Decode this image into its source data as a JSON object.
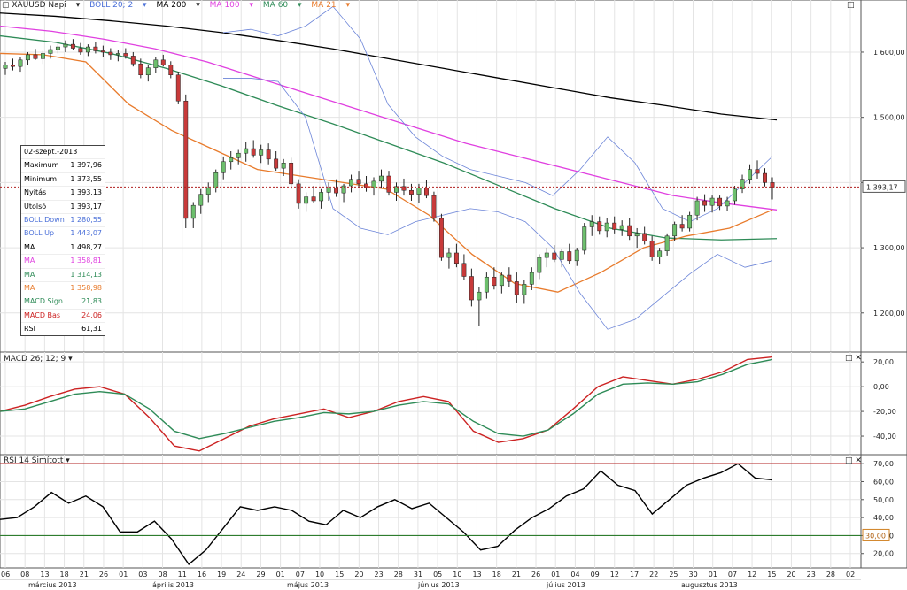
{
  "toolbar": {
    "symbol": "XAUUSD Napi",
    "indicators": [
      {
        "label": "BOLL 20; 2",
        "color": "#4a6fd8"
      },
      {
        "label": "MA 200",
        "color": "#000000"
      },
      {
        "label": "MA 100",
        "color": "#e040e0"
      },
      {
        "label": "MA 60",
        "color": "#2e8b57"
      },
      {
        "label": "MA 21",
        "color": "#e87b2c"
      }
    ]
  },
  "infobox": {
    "date": "02-szept.-2013",
    "rows": [
      {
        "label": "Maximum",
        "value": "1 397,96",
        "color": "#000000"
      },
      {
        "label": "Minimum",
        "value": "1 373,55",
        "color": "#000000"
      },
      {
        "label": "Nyitás",
        "value": "1 393,13",
        "color": "#000000"
      },
      {
        "label": "Utolsó",
        "value": "1 393,17",
        "color": "#000000"
      },
      {
        "label": "BOLL Down",
        "value": "1 280,55",
        "color": "#4a6fd8"
      },
      {
        "label": "BOLL Up",
        "value": "1 443,07",
        "color": "#4a6fd8"
      },
      {
        "label": "MA",
        "value": "1 498,27",
        "color": "#000000"
      },
      {
        "label": "MA",
        "value": "1 358,81",
        "color": "#e040e0"
      },
      {
        "label": "MA",
        "value": "1 314,13",
        "color": "#2e8b57"
      },
      {
        "label": "MA",
        "value": "1 358,98",
        "color": "#e87b2c"
      },
      {
        "label": "MACD Sign",
        "value": "21,83",
        "color": "#2e8b57"
      },
      {
        "label": "MACD Bas",
        "value": "24,06",
        "color": "#cc2222"
      },
      {
        "label": "RSI",
        "value": "61,31",
        "color": "#000000"
      }
    ]
  },
  "panels": {
    "macd_label": "MACD 26; 12; 9",
    "rsi_label": "RSI 14 Simított"
  },
  "last_price_label": "1 393,17",
  "rsi_level_label": "30,00",
  "x_ticks": [
    "06",
    "08",
    "13",
    "18",
    "21",
    "26",
    "01",
    "03",
    "08",
    "11",
    "16",
    "19",
    "24",
    "29",
    "01",
    "07",
    "10",
    "15",
    "20",
    "23",
    "28",
    "31",
    "05",
    "10",
    "13",
    "18",
    "21",
    "26",
    "01",
    "04",
    "09",
    "12",
    "17",
    "22",
    "25",
    "30",
    "01",
    "07",
    "12",
    "15",
    "20",
    "23",
    "28",
    "02"
  ],
  "month_labels": [
    "március 2013",
    "április 2013",
    "május 2013",
    "június 2013",
    "július 2013",
    "augusztus 2013"
  ],
  "chart_data": [
    {
      "type": "line",
      "title": "XAUUSD Napi",
      "ylim": [
        1140,
        1680
      ],
      "y_ticks": [
        "1 600,00",
        "1 500,00",
        "1 400,00",
        "1 300,00",
        "1 200,00"
      ],
      "candles": [
        [
          1575,
          1585,
          1565,
          1580
        ],
        [
          1580,
          1590,
          1572,
          1578
        ],
        [
          1578,
          1592,
          1570,
          1588
        ],
        [
          1588,
          1600,
          1580,
          1596
        ],
        [
          1596,
          1605,
          1588,
          1590
        ],
        [
          1590,
          1602,
          1582,
          1598
        ],
        [
          1598,
          1610,
          1590,
          1604
        ],
        [
          1604,
          1615,
          1598,
          1608
        ],
        [
          1608,
          1618,
          1600,
          1612
        ],
        [
          1612,
          1620,
          1604,
          1606
        ],
        [
          1606,
          1614,
          1596,
          1600
        ],
        [
          1600,
          1612,
          1594,
          1608
        ],
        [
          1608,
          1616,
          1598,
          1602
        ],
        [
          1602,
          1610,
          1592,
          1600
        ],
        [
          1600,
          1606,
          1588,
          1596
        ],
        [
          1596,
          1604,
          1586,
          1598
        ],
        [
          1598,
          1606,
          1590,
          1594
        ],
        [
          1594,
          1600,
          1578,
          1582
        ],
        [
          1582,
          1590,
          1560,
          1565
        ],
        [
          1565,
          1580,
          1555,
          1576
        ],
        [
          1576,
          1592,
          1568,
          1588
        ],
        [
          1588,
          1596,
          1578,
          1580
        ],
        [
          1580,
          1586,
          1560,
          1565
        ],
        [
          1565,
          1570,
          1520,
          1525
        ],
        [
          1525,
          1535,
          1330,
          1345
        ],
        [
          1345,
          1370,
          1330,
          1365
        ],
        [
          1365,
          1390,
          1352,
          1382
        ],
        [
          1382,
          1400,
          1370,
          1392
        ],
        [
          1392,
          1420,
          1385,
          1415
        ],
        [
          1415,
          1440,
          1405,
          1432
        ],
        [
          1432,
          1448,
          1420,
          1438
        ],
        [
          1438,
          1450,
          1428,
          1445
        ],
        [
          1445,
          1462,
          1432,
          1452
        ],
        [
          1452,
          1465,
          1438,
          1442
        ],
        [
          1442,
          1458,
          1430,
          1450
        ],
        [
          1450,
          1460,
          1428,
          1436
        ],
        [
          1436,
          1448,
          1418,
          1422
        ],
        [
          1422,
          1436,
          1410,
          1430
        ],
        [
          1430,
          1438,
          1390,
          1398
        ],
        [
          1398,
          1405,
          1360,
          1368
        ],
        [
          1368,
          1385,
          1355,
          1378
        ],
        [
          1378,
          1395,
          1368,
          1372
        ],
        [
          1372,
          1390,
          1360,
          1385
        ],
        [
          1385,
          1400,
          1372,
          1392
        ],
        [
          1392,
          1405,
          1378,
          1384
        ],
        [
          1384,
          1398,
          1370,
          1395
        ],
        [
          1395,
          1412,
          1385,
          1405
        ],
        [
          1405,
          1418,
          1392,
          1398
        ],
        [
          1398,
          1410,
          1386,
          1392
        ],
        [
          1392,
          1408,
          1380,
          1402
        ],
        [
          1402,
          1420,
          1392,
          1410
        ],
        [
          1410,
          1418,
          1380,
          1385
        ],
        [
          1385,
          1400,
          1372,
          1394
        ],
        [
          1394,
          1406,
          1380,
          1388
        ],
        [
          1388,
          1398,
          1372,
          1382
        ],
        [
          1382,
          1398,
          1368,
          1392
        ],
        [
          1392,
          1404,
          1376,
          1380
        ],
        [
          1380,
          1386,
          1340,
          1345
        ],
        [
          1345,
          1352,
          1280,
          1285
        ],
        [
          1285,
          1300,
          1268,
          1292
        ],
        [
          1292,
          1306,
          1270,
          1276
        ],
        [
          1276,
          1290,
          1250,
          1256
        ],
        [
          1256,
          1268,
          1210,
          1220
        ],
        [
          1220,
          1240,
          1180,
          1232
        ],
        [
          1232,
          1262,
          1222,
          1255
        ],
        [
          1255,
          1270,
          1236,
          1242
        ],
        [
          1242,
          1262,
          1230,
          1258
        ],
        [
          1258,
          1270,
          1240,
          1248
        ],
        [
          1248,
          1262,
          1216,
          1228
        ],
        [
          1228,
          1250,
          1214,
          1244
        ],
        [
          1244,
          1270,
          1235,
          1262
        ],
        [
          1262,
          1290,
          1252,
          1285
        ],
        [
          1285,
          1300,
          1270,
          1292
        ],
        [
          1292,
          1304,
          1278,
          1282
        ],
        [
          1282,
          1298,
          1270,
          1294
        ],
        [
          1294,
          1306,
          1275,
          1280
        ],
        [
          1280,
          1300,
          1272,
          1296
        ],
        [
          1296,
          1338,
          1290,
          1332
        ],
        [
          1332,
          1350,
          1318,
          1340
        ],
        [
          1340,
          1348,
          1320,
          1326
        ],
        [
          1326,
          1345,
          1316,
          1338
        ],
        [
          1338,
          1348,
          1322,
          1328
        ],
        [
          1328,
          1342,
          1318,
          1334
        ],
        [
          1334,
          1345,
          1312,
          1318
        ],
        [
          1318,
          1330,
          1300,
          1322
        ],
        [
          1322,
          1332,
          1305,
          1310
        ],
        [
          1310,
          1318,
          1280,
          1286
        ],
        [
          1286,
          1300,
          1275,
          1295
        ],
        [
          1295,
          1322,
          1288,
          1318
        ],
        [
          1318,
          1340,
          1310,
          1336
        ],
        [
          1336,
          1350,
          1325,
          1330
        ],
        [
          1330,
          1355,
          1325,
          1350
        ],
        [
          1350,
          1378,
          1342,
          1372
        ],
        [
          1372,
          1382,
          1355,
          1365
        ],
        [
          1365,
          1380,
          1354,
          1376
        ],
        [
          1376,
          1380,
          1358,
          1364
        ],
        [
          1364,
          1378,
          1356,
          1372
        ],
        [
          1372,
          1395,
          1366,
          1390
        ],
        [
          1390,
          1412,
          1384,
          1405
        ],
        [
          1405,
          1428,
          1398,
          1420
        ],
        [
          1420,
          1434,
          1406,
          1414
        ],
        [
          1414,
          1422,
          1394,
          1400
        ],
        [
          1400,
          1408,
          1374,
          1393
        ]
      ],
      "series": [
        {
          "name": "MA 200",
          "color": "#000000",
          "values": [
            1660,
            1655,
            1648,
            1640,
            1630,
            1618,
            1605,
            1590,
            1575,
            1560,
            1545,
            1530,
            1518,
            1505,
            1496
          ]
        },
        {
          "name": "MA 100",
          "color": "#e040e0",
          "values": [
            1640,
            1632,
            1620,
            1605,
            1585,
            1560,
            1535,
            1510,
            1485,
            1460,
            1440,
            1420,
            1400,
            1380,
            1368,
            1358
          ]
        },
        {
          "name": "MA 60",
          "color": "#2e8b57",
          "values": [
            1625,
            1615,
            1598,
            1575,
            1548,
            1518,
            1490,
            1460,
            1430,
            1395,
            1360,
            1330,
            1315,
            1312,
            1314
          ]
        },
        {
          "name": "MA 21",
          "color": "#e87b2c",
          "values": [
            1598,
            1596,
            1585,
            1520,
            1480,
            1450,
            1420,
            1410,
            1400,
            1390,
            1350,
            1290,
            1245,
            1232,
            1262,
            1300,
            1318,
            1330,
            1358
          ]
        },
        {
          "name": "BOLL Up",
          "color": "#6b84d8",
          "values": [
            1630,
            1635,
            1625,
            1640,
            1670,
            1620,
            1520,
            1470,
            1440,
            1420,
            1410,
            1400,
            1380,
            1420,
            1470,
            1430,
            1360,
            1340,
            1360,
            1400,
            1440
          ]
        },
        {
          "name": "BOLL Down",
          "color": "#6b84d8",
          "values": [
            1560,
            1560,
            1555,
            1500,
            1360,
            1330,
            1320,
            1340,
            1350,
            1360,
            1355,
            1340,
            1300,
            1230,
            1175,
            1190,
            1225,
            1260,
            1290,
            1270,
            1280
          ]
        }
      ]
    },
    {
      "type": "line",
      "title": "MACD 26; 12; 9",
      "ylim": [
        -55,
        28
      ],
      "y_ticks": [
        "20,00",
        "0,00",
        "-20,00",
        "-40,00"
      ],
      "series": [
        {
          "name": "MACD Bas",
          "color": "#cc2222",
          "values": [
            -20,
            -15,
            -8,
            -2,
            0,
            -6,
            -25,
            -48,
            -52,
            -42,
            -32,
            -26,
            -22,
            -18,
            -25,
            -20,
            -12,
            -8,
            -12,
            -36,
            -45,
            -42,
            -35,
            -18,
            0,
            8,
            5,
            2,
            6,
            12,
            22,
            24
          ]
        },
        {
          "name": "MACD Sign",
          "color": "#2e8b57",
          "values": [
            -20,
            -18,
            -12,
            -6,
            -4,
            -6,
            -18,
            -36,
            -42,
            -38,
            -33,
            -28,
            -25,
            -21,
            -22,
            -20,
            -15,
            -12,
            -14,
            -28,
            -38,
            -40,
            -35,
            -22,
            -6,
            2,
            3,
            2,
            4,
            10,
            18,
            22
          ]
        }
      ]
    },
    {
      "type": "line",
      "title": "RSI 14 Simított",
      "ylim": [
        12,
        75
      ],
      "y_ticks": [
        "70,00",
        "60,00",
        "50,00",
        "40,00",
        "30,00",
        "20,00"
      ],
      "series": [
        {
          "name": "RSI",
          "color": "#000000",
          "values": [
            39,
            40,
            46,
            54,
            48,
            52,
            46,
            32,
            32,
            38,
            28,
            14,
            22,
            34,
            46,
            44,
            46,
            44,
            38,
            36,
            44,
            40,
            46,
            50,
            45,
            48,
            40,
            32,
            22,
            24,
            33,
            40,
            45,
            52,
            56,
            66,
            58,
            55,
            42,
            50,
            58,
            62,
            65,
            70,
            62,
            61
          ]
        }
      ]
    }
  ]
}
